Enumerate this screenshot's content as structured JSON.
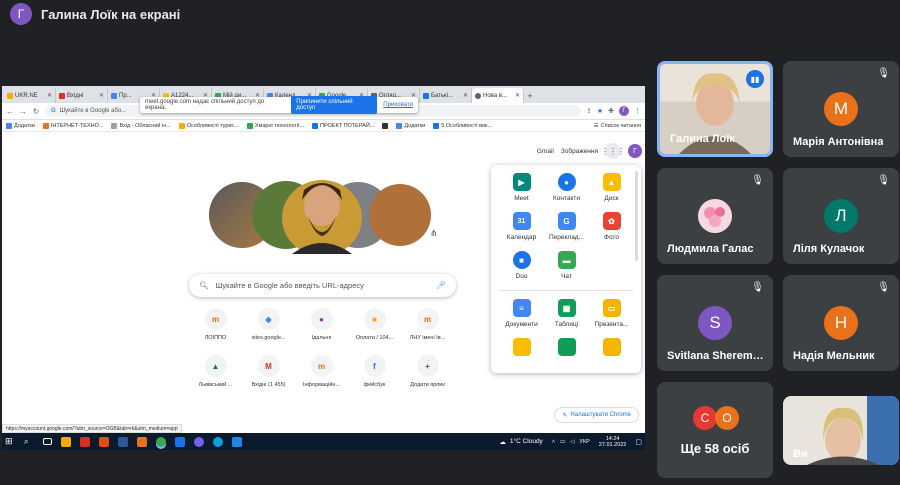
{
  "meet": {
    "presenter_initial": "Г",
    "presenter_title": "Галина Лоїк на екрані"
  },
  "browser": {
    "tabs": [
      "UKR.NE",
      "Вхідні",
      "Пр...",
      "A1224...",
      "Мій ди...",
      "Календ...",
      "Google ...",
      "Огляд...",
      "Батькі...",
      "Нова в..."
    ],
    "share_bar": {
      "text": "meet.google.com надає спільний доступ до екрана.",
      "stop_button": "Припинити спільний доступ",
      "hide_link": "Приховати"
    },
    "omnibox": "Шукайте в Google або...",
    "profile_initial": "Г",
    "bookmarks": [
      "Додатки",
      "ІНТЕРНЕТ-ТЕХНО...",
      "Вхід - Обласний ін...",
      "Особливості турис...",
      "Хмарні технології...",
      "ПРОЕКТ ПОТЕРАЙ...",
      "",
      "Додатки",
      "5.Особливості вик..."
    ],
    "reading_list": "Список читання"
  },
  "newtab": {
    "gmail": "Gmail",
    "images": "Зображення",
    "search_placeholder": "Шукайте в Google або введіть URL-адресу",
    "shortcuts": [
      {
        "label": "ЛОІППО",
        "glyph": "m",
        "color": "#e37400"
      },
      {
        "label": "sites.google...",
        "glyph": "◆",
        "color": "#4285f4"
      },
      {
        "label": "Ідальня",
        "glyph": "●",
        "color": "#9c27b0"
      },
      {
        "label": "Оплати / 104...",
        "glyph": "■",
        "color": "#f9ab00"
      },
      {
        "label": "ЛНУ імені Ів...",
        "glyph": "m",
        "color": "#e37400"
      },
      {
        "label": "Львівський ...",
        "glyph": "▲",
        "color": "#137333"
      },
      {
        "label": "Вхідні (1 455)",
        "glyph": "M",
        "color": "#d93025"
      },
      {
        "label": "Інформаційн...",
        "glyph": "m",
        "color": "#e37400"
      },
      {
        "label": "фейсбук",
        "glyph": "f",
        "color": "#1877f2"
      },
      {
        "label": "Додати ярлик",
        "glyph": "+",
        "color": "#555555"
      }
    ],
    "customize": "Налаштувати Chrome",
    "status_url": "https://myaccount.google.com/?utm_source=OGB&tab=rk&utm_medium=app"
  },
  "apps_menu": {
    "items": [
      {
        "label": "Meet",
        "color": "#00897b",
        "glyph": "▶"
      },
      {
        "label": "Контакти",
        "color": "#1a73e8",
        "glyph": "●"
      },
      {
        "label": "Диск",
        "color": "#fbbc04",
        "glyph": "▲"
      },
      {
        "label": "Календар",
        "color": "#4285f4",
        "glyph": "31"
      },
      {
        "label": "Переклад...",
        "color": "#4285f4",
        "glyph": "G"
      },
      {
        "label": "Фото",
        "color": "#ea4335",
        "glyph": "✿"
      },
      {
        "label": "Duo",
        "color": "#1a73e8",
        "glyph": "■"
      },
      {
        "label": "Чат",
        "color": "#34a853",
        "glyph": "▬"
      },
      {
        "label": "Документи",
        "color": "#4285f4",
        "glyph": "≡"
      },
      {
        "label": "Таблиці",
        "color": "#0f9d58",
        "glyph": "▦"
      },
      {
        "label": "Презента...",
        "color": "#f4b400",
        "glyph": "▭"
      }
    ]
  },
  "taskbar": {
    "weather": "1°C  Cloudy",
    "lang": "УКР",
    "time": "14:24",
    "date": "27.01.2022"
  },
  "participants": [
    {
      "name": "Галина Лоїк",
      "type": "video",
      "speaking": true
    },
    {
      "name": "Марія Антонівна",
      "initial": "М",
      "color": "#e8711a",
      "muted": true
    },
    {
      "name": "Людмила Галас",
      "type": "avatar-photo",
      "muted": true
    },
    {
      "name": "Ліля Кулачок",
      "initial": "Л",
      "color": "#00796b",
      "muted": true
    },
    {
      "name": "Svitlana Sheremeta",
      "initial": "S",
      "color": "#7e57c2",
      "muted": true
    },
    {
      "name": "Надія Мельник",
      "initial": "Н",
      "color": "#e8711a",
      "muted": true
    },
    {
      "more_label": "Ще 58 осіб",
      "initials": [
        "С",
        "О"
      ],
      "colors": [
        "#e53935",
        "#e8711a"
      ]
    },
    {
      "name": "Ви",
      "type": "video"
    }
  ]
}
